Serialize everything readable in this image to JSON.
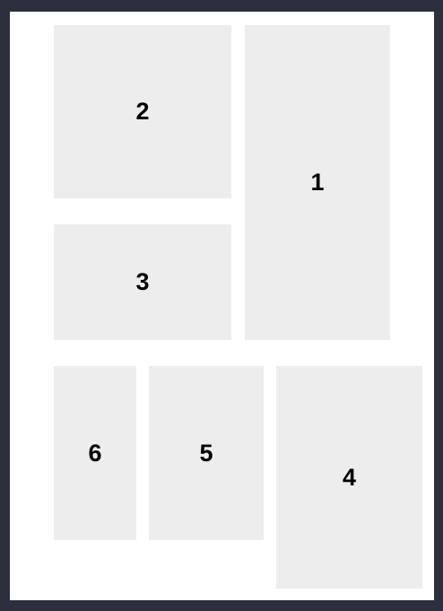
{
  "colors": {
    "background": "#2e2f3d",
    "page": "#ffffff",
    "panel": "#ededed",
    "label": "#000000"
  },
  "panels": [
    {
      "id": "panel-1",
      "label": "1"
    },
    {
      "id": "panel-2",
      "label": "2"
    },
    {
      "id": "panel-3",
      "label": "3"
    },
    {
      "id": "panel-4",
      "label": "4"
    },
    {
      "id": "panel-5",
      "label": "5"
    },
    {
      "id": "panel-6",
      "label": "6"
    }
  ]
}
